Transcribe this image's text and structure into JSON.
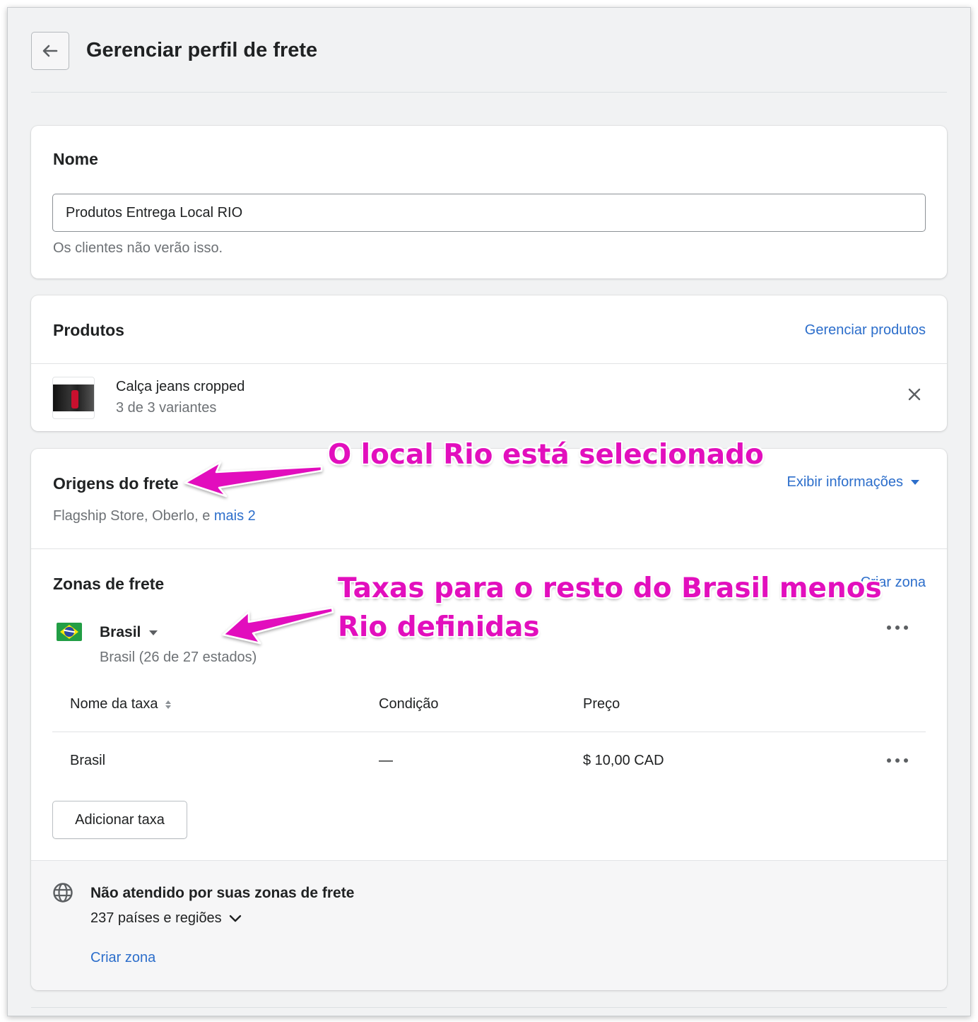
{
  "header": {
    "back_icon": "arrow-left-icon",
    "title": "Gerenciar perfil de frete"
  },
  "name_card": {
    "label": "Nome",
    "input_value": "Produtos Entrega Local RIO",
    "help_text": "Os clientes não verão isso."
  },
  "products_card": {
    "title": "Produtos",
    "manage_link": "Gerenciar produtos",
    "items": [
      {
        "name": "Calça jeans cropped",
        "variants": "3 de 3 variantes",
        "remove_icon": "close-icon"
      }
    ]
  },
  "origins": {
    "title": "Origens do frete",
    "info_link": "Exibir informações",
    "list_prefix": "Flagship Store, Oberlo, e ",
    "list_more": "mais 2"
  },
  "zones": {
    "title": "Zonas de frete",
    "create_link": "Criar zona",
    "zone": {
      "name": "Brasil",
      "flag_icon": "brazil-flag-icon",
      "description": "Brasil (26 de 27 estados)"
    },
    "table": {
      "headers": {
        "name": "Nome da taxa",
        "condition": "Condição",
        "price": "Preço"
      },
      "rows": [
        {
          "name": "Brasil",
          "condition": "—",
          "price": "$ 10,00 CAD"
        }
      ]
    },
    "add_rate_label": "Adicionar taxa"
  },
  "not_covered": {
    "icon": "globe-icon",
    "title": "Não atendido por suas zonas de frete",
    "count": "237 países e regiões",
    "create_link": "Criar zona"
  },
  "annotations": {
    "line1": "O local Rio está selecionado",
    "line2a": "Taxas para o resto do Brasil menos",
    "line2b": "Rio definidas",
    "color": "#e20fbd"
  },
  "colors": {
    "link": "#2c6ecb",
    "page_background": "#f1f2f3",
    "text": "#202223",
    "subdued": "#6d7175"
  }
}
